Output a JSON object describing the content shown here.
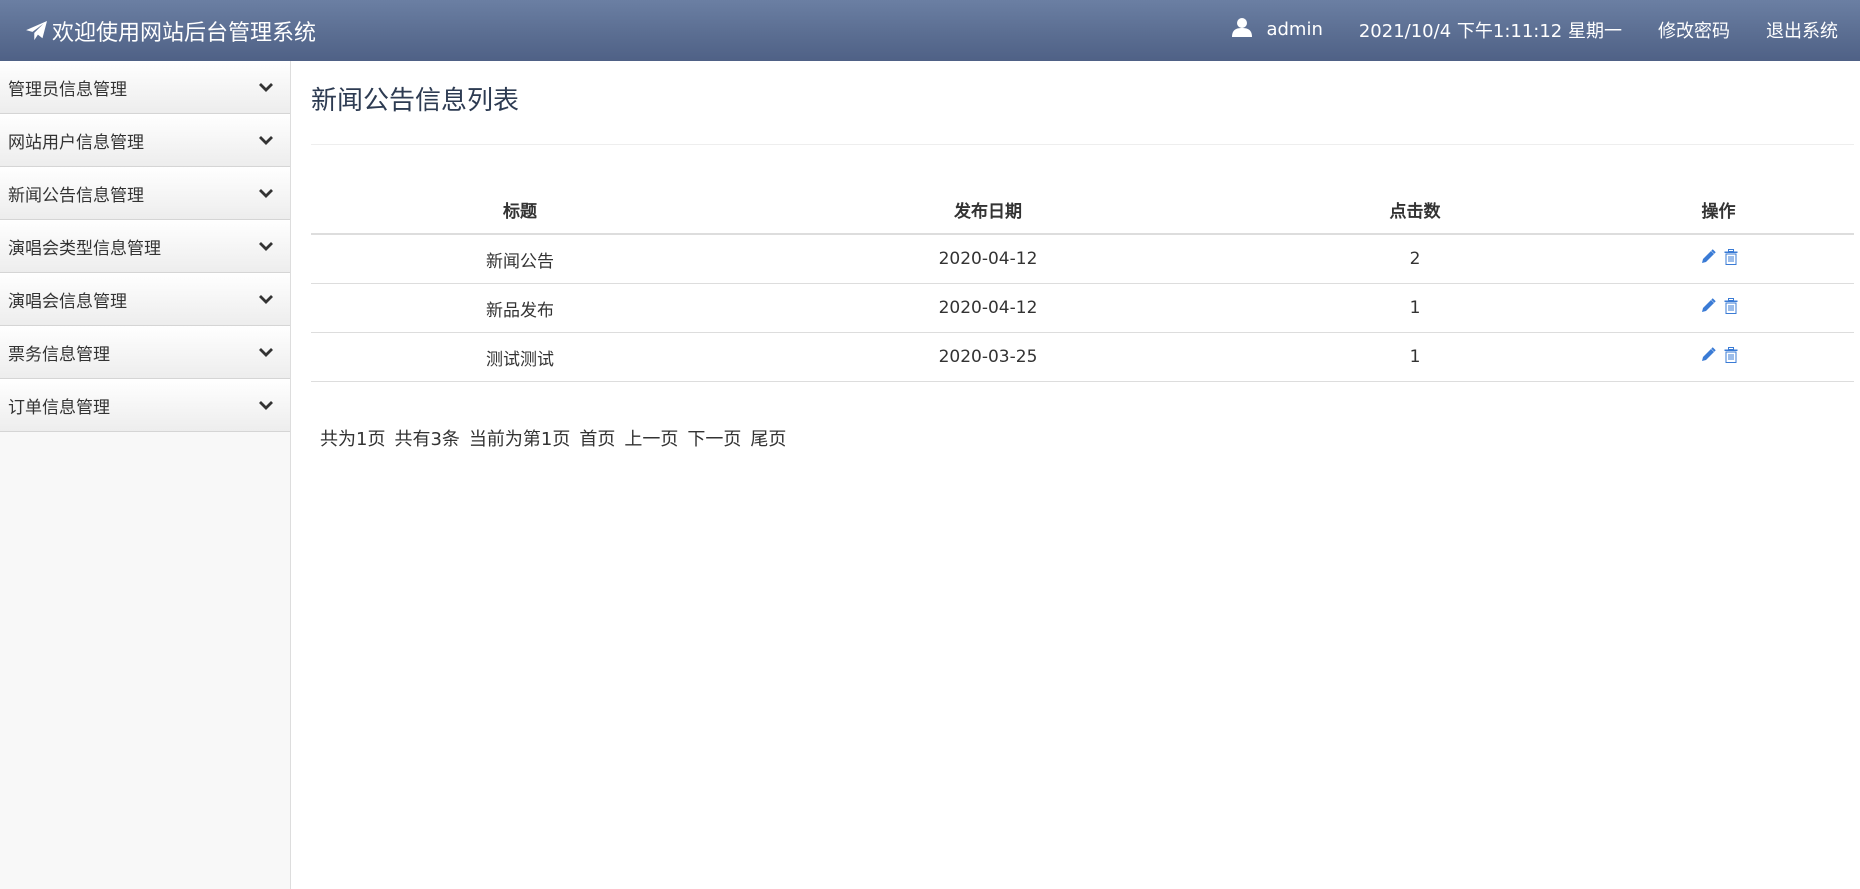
{
  "header": {
    "brand_title": "欢迎使用网站后台管理系统",
    "username": "admin",
    "datetime": "2021/10/4 下午1:11:12 星期一",
    "change_password": "修改密码",
    "logout": "退出系统"
  },
  "sidebar": {
    "items": [
      {
        "label": "管理员信息管理"
      },
      {
        "label": "网站用户信息管理"
      },
      {
        "label": "新闻公告信息管理"
      },
      {
        "label": "演唱会类型信息管理"
      },
      {
        "label": "演唱会信息管理"
      },
      {
        "label": "票务信息管理"
      },
      {
        "label": "订单信息管理"
      }
    ]
  },
  "main": {
    "title": "新闻公告信息列表",
    "table": {
      "columns": [
        "标题",
        "发布日期",
        "点击数",
        "操作"
      ],
      "rows": [
        {
          "title": "新闻公告",
          "date": "2020-04-12",
          "clicks": "2"
        },
        {
          "title": "新品发布",
          "date": "2020-04-12",
          "clicks": "1"
        },
        {
          "title": "测试测试",
          "date": "2020-03-25",
          "clicks": "1"
        }
      ]
    },
    "pager": {
      "total_pages": "共为1页",
      "total_records": "共有3条",
      "current": "当前为第1页",
      "first": "首页",
      "prev": "上一页",
      "next": "下一页",
      "last": "尾页"
    }
  },
  "colors": {
    "header_bg": "#5b6e92",
    "icon_blue": "#3a7bd5"
  },
  "icons": {
    "brand": "paper-plane-icon",
    "user": "user-icon",
    "menu_toggle": "chevron-down-icon",
    "edit": "pencil-icon",
    "delete": "trash-icon"
  }
}
